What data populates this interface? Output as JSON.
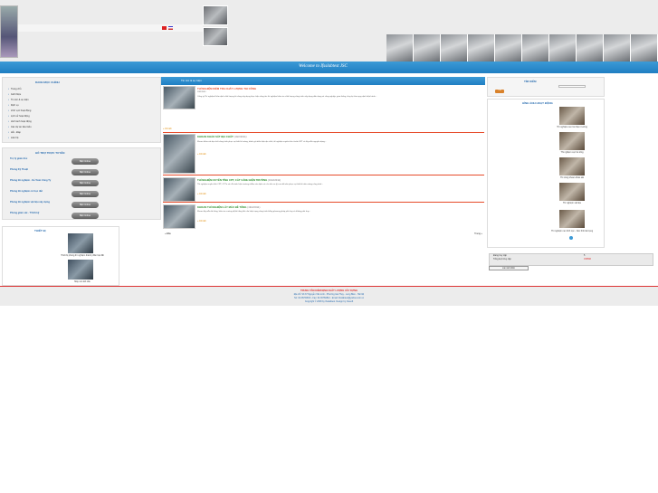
{
  "header": {
    "welcome": "Welcome to Ifsslabtest JSC"
  },
  "menu": {
    "title": "DANH MỤC CHÍNH",
    "items": [
      "Trang chủ",
      "Giới thiệu",
      "Tin tức & sự kiện",
      "Dịch vụ",
      "Lĩnh vực hoạt động",
      "Lịch sử hoạt động",
      "Hình ảnh hoạt động",
      "Các dự án tiêu biểu",
      "Hỏi - Đáp",
      "Liên hệ"
    ]
  },
  "support": {
    "title": "HỖ TRỢ TRỰC TUYẾN",
    "rows": [
      {
        "name": "Trợ lý giám đốc",
        "button": "Bật Online"
      },
      {
        "name": "Phòng Kỹ Thuật",
        "button": "Bật Online"
      },
      {
        "name": "Phòng thí nghiệm - Kế Toán Công Ty",
        "button": "Bật Online"
      },
      {
        "name": "Phòng thí nghiệm cơ học đất",
        "button": "Bật Online"
      },
      {
        "name": "Phòng thí nghiệm vật liệu xây dựng",
        "button": "Bật Online"
      },
      {
        "name": "Phòng giám sát - TVGS kỹ",
        "button": "Bật Online"
      }
    ]
  },
  "equipment": {
    "title": "THIẾT BỊ",
    "items": [
      {
        "caption": "Thiết bị phòng thí nghiệm thành phần hạt đất"
      },
      {
        "caption": "Máy nén kết cấu"
      }
    ]
  },
  "center": {
    "header": "Tin tức & sự kiện",
    "articles": [
      {
        "title": "THÍ NGHIỆM KIỂM TRA CHẤT LƯỢNG THI CÔNG",
        "date": "19/2/2011",
        "more": "» Chi tiết",
        "text": "Công ty Thí nghiệm Kiểm định chất lượng thi công xây dựng thực hiện công tác thí nghiệm kiểm tra chất lượng công trình xây dựng dân dụng và công nghiệp, giao thông, thủy lợi theo quy định hiện hành..."
      },
      {
        "title": "KHOAN KHẢO SÁT ĐỊA CHẤT",
        "date": "(19/2/2011)",
        "more": "» Chi tiết",
        "text": "Khoan khảo sát địa chất công trình phục vụ thiết kế móng, đánh giá điều kiện địa chất, thí nghiệm xuyên tiêu chuẩn SPT và lấy mẫu nguyên dạng..."
      },
      {
        "title": "THÍ NGHIỆM XUYÊN TĨNH CPT, CẮT CÁNH HIỆN TRƯỜNG",
        "date": "(19/2/2011)",
        "more": "» Chi tiết",
        "text": "Thí nghiệm xuyên tĩnh CPT, CPTu và cắt cánh hiện trường nhằm xác định các chỉ tiêu cơ lý của đất nền phục vụ thiết kế nền móng công trình..."
      },
      {
        "title": "KHOAN THÍ NGHIỆM LẤY MẪU BÊ TÔNG",
        "date": "(19/2/2011)",
        "more": "» Chi tiết",
        "text": "Khoan lấy mẫu bê tông, kiểm tra cường độ bê tông kết cấu hiện trạng công trình bằng phương pháp phá hủy và không phá hủy..."
      }
    ],
    "pager_prev": "« Đầu",
    "pager_next": "Trang »"
  },
  "search": {
    "title": "TÌM KIẾM",
    "button": "Tìm"
  },
  "activity": {
    "title": "HÌNH ẢNH HOẠT ĐỘNG",
    "captions": [
      "Thí nghiệm nén lún hiện trường",
      "Thí nghiệm cọc bê tông",
      "Thi công khoan khảo sát",
      "Thí nghiệm vật liệu",
      "Thí nghiệm nén tĩnh cọc - Nén tĩnh tải trọng"
    ]
  },
  "stats": {
    "rows": [
      {
        "label": "Đang truy cập",
        "value": "5"
      },
      {
        "label": "Tổng lượt truy cập",
        "value": "158896"
      }
    ],
    "weblink": "Liên kết Web"
  },
  "footer": {
    "line1": "TRUNG TÂM KIỂM ĐỊNH CHẤT LƯỢNG XÂY DỰNG",
    "line2": "Địa chỉ: Số 37 Nguyễn Văn Linh - Phường Gia Thụy - Long Biên - Hà Nội",
    "line3": "Tel: 04.36760813 - Fax: 04.36760812 - Email: ifsslabtest@yahoo.com.vn",
    "line4": "Copyright © 2008 by Ifsslabtest. Design by Clesoft"
  },
  "colors": {
    "accent_blue": "#1f7ec2",
    "title_green": "#2a8c2a",
    "title_red": "#e64b2a",
    "button_gray": "#5f5f5f"
  }
}
